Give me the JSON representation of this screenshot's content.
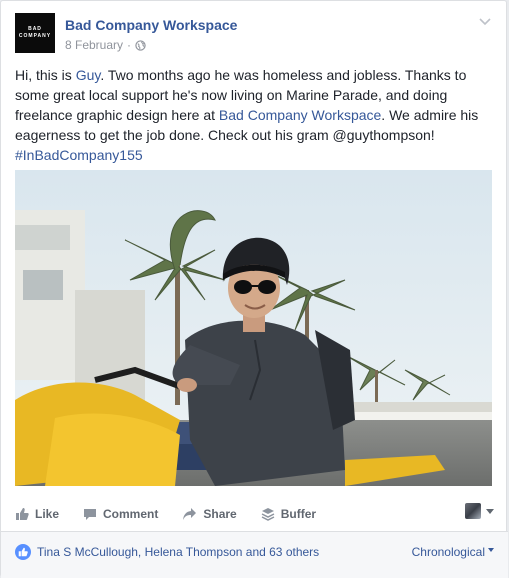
{
  "page": {
    "name": "Bad Company Workspace",
    "avatar_text_line1": "BAD",
    "avatar_text_line2": "COMPANY",
    "date": "8 February",
    "separator": "·",
    "privacy_icon": "globe-icon"
  },
  "post": {
    "text_part1": "Hi, this is ",
    "link_guy": "Guy",
    "text_part2": ". Two months ago he was homeless and jobless. Thanks to some great local support he's now living on Marine Parade, and doing freelance graphic design here at ",
    "link_workspace": "Bad Company Workspace",
    "text_part3": ". We admire his eagerness to get the job done. Check out his gram @guythompson!",
    "hashtag": "#InBadCompany155",
    "photo_alt": "Man in helmet and sunglasses riding a yellow scooter"
  },
  "actions": {
    "like": "Like",
    "comment": "Comment",
    "share": "Share",
    "buffer": "Buffer"
  },
  "reactions": {
    "likers": "Tina S McCullough, Helena Thompson and 63 others",
    "sort": "Chronological"
  },
  "colors": {
    "link": "#365899",
    "like_blue": "#5890ff",
    "muted": "#90949c"
  }
}
